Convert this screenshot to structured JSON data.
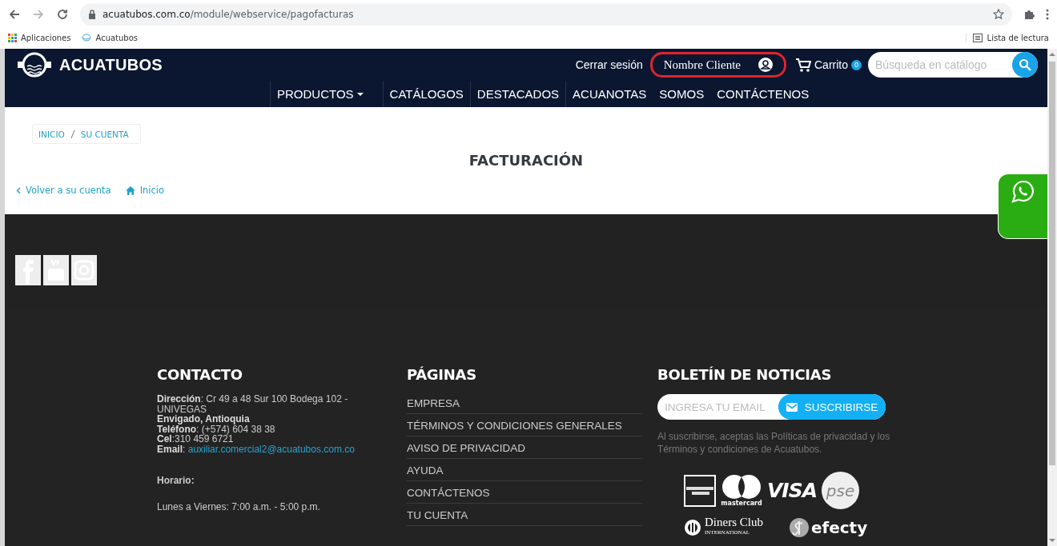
{
  "browser": {
    "url_host": "acuatubos.com.co",
    "url_path": "/module/webservice/pagofacturas",
    "bookmarks": [
      {
        "kind": "apps",
        "label": "Aplicaciones"
      },
      {
        "kind": "site",
        "label": "Acuatubos"
      }
    ],
    "reading_list": "Lista de lectura"
  },
  "header": {
    "logo": "ACUATUBOS",
    "logout": "Cerrar sesión",
    "account": {
      "name": "Nombre Cliente",
      "highlighted": true
    },
    "cart": {
      "label": "Carrito",
      "count": "0"
    },
    "search": {
      "placeholder": "Búsqueda en catálogo"
    },
    "nav": [
      {
        "label": "PRODUCTOS",
        "dropdown": true
      },
      {
        "label": "CATÁLOGOS",
        "dropdown": false
      },
      {
        "label": "DESTACADOS",
        "dropdown": false
      },
      {
        "label": "ACUANOTAS",
        "dropdown": false
      },
      {
        "label": "SOMOS",
        "dropdown": false
      },
      {
        "label": "CONTÁCTENOS",
        "dropdown": false
      }
    ]
  },
  "content": {
    "breadcrumb": [
      "INICIO",
      "SU CUENTA"
    ],
    "title": "FACTURACIÓN",
    "links": [
      {
        "kind": "back",
        "label": "Volver a su cuenta"
      },
      {
        "kind": "home",
        "label": "Inicio"
      }
    ]
  },
  "footer": {
    "social": [
      {
        "kind": "facebook"
      },
      {
        "kind": "youtube"
      },
      {
        "kind": "instagram"
      }
    ],
    "contact": {
      "title": "CONTACTO",
      "lines": [
        {
          "kind": "text",
          "text": "**Dirección**: Cr 49 a 48 Sur 100 Bodega 102 - UNIVEGAS"
        },
        {
          "kind": "strong",
          "text": "Envigado, Antioquia"
        },
        {
          "kind": "text",
          "text": "**Teléfono**: (+574) 604 38 38"
        },
        {
          "kind": "text",
          "text": "**Cel**:310 459 6721"
        },
        {
          "kind": "email",
          "text": "**Email**:",
          "link": "auxiliar.comercial2@acuatubos.com.co"
        }
      ],
      "hours_title": "Horario:",
      "hours": "Lunes a Viernes: 7:00 a.m. - 5:00 p.m."
    },
    "pages": {
      "title": "PÁGINAS",
      "items": [
        "EMPRESA",
        "TÉRMINOS Y CONDICIONES GENERALES",
        "AVISO DE PRIVACIDAD",
        "AYUDA",
        "CONTÁCTENOS",
        "TU CUENTA"
      ]
    },
    "newsletter": {
      "title": "BOLETÍN DE NOTICIAS",
      "placeholder": "INGRESA TU EMAIL",
      "button": "SUSCRIBIRSE",
      "note": "Al suscribirse, aceptas las Políticas de privacidad y los Términos y condiciones de Acuatubos."
    },
    "payments": [
      {
        "kind": "amex"
      },
      {
        "kind": "mastercard",
        "text": "mastercard"
      },
      {
        "kind": "visa",
        "text": "VISA"
      },
      {
        "kind": "pse",
        "text": "pse"
      },
      {
        "kind": "diners",
        "text": "Diners Club",
        "sub": "INTERNATIONAL"
      },
      {
        "kind": "efecty",
        "text": "efecty"
      }
    ]
  }
}
